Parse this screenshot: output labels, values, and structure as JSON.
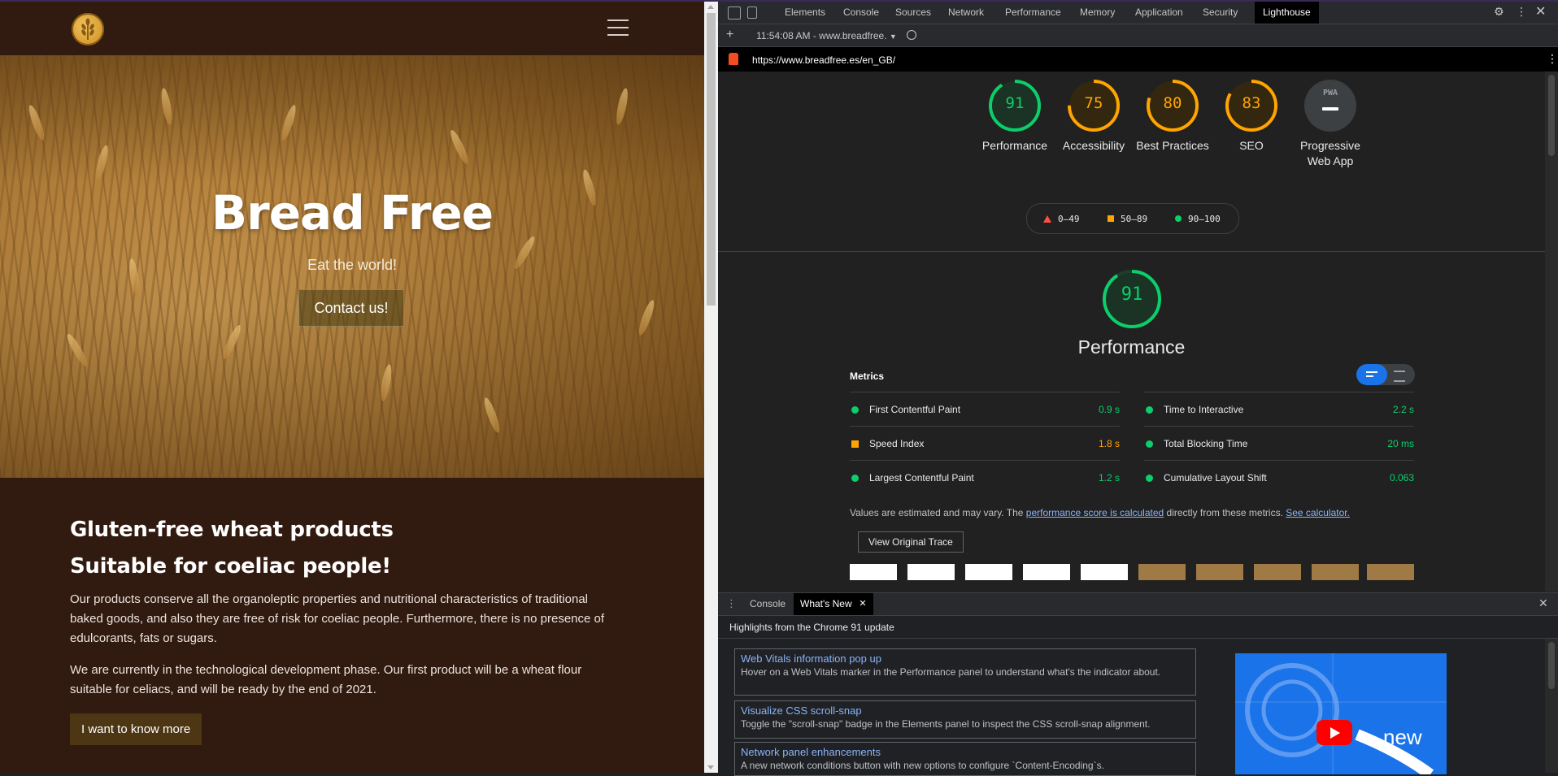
{
  "site": {
    "hero_title": "Bread Free",
    "hero_subtitle": "Eat the world!",
    "hero_button": "Contact us!",
    "heading_1": "Gluten-free wheat products",
    "heading_2": "Suitable for coeliac people!",
    "paragraph_1": "Our products conserve all the organoleptic properties and nutritional characteristics of traditional baked goods, and also they are free of risk for coeliac people. Furthermore, there is no presence of edulcorants, fats or sugars.",
    "paragraph_2": "We are currently in the technological development phase. Our first product will be a wheat flour suitable for celiacs, and will be ready by the end of 2021.",
    "know_button": "I want to know more"
  },
  "devtools": {
    "tabs": [
      "Elements",
      "Console",
      "Sources",
      "Network",
      "Performance",
      "Memory",
      "Application",
      "Security",
      "Lighthouse"
    ],
    "active_tab": "Lighthouse",
    "report_selector": "11:54:08 AM - www.breadfree.",
    "url": "https://www.breadfree.es/en_GB/"
  },
  "lighthouse": {
    "scores": [
      {
        "label": "Performance",
        "value": "91",
        "score": 91,
        "color": "#0cce6b"
      },
      {
        "label": "Accessibility",
        "value": "75",
        "score": 75,
        "color": "#ffa400"
      },
      {
        "label": "Best Practices",
        "value": "80",
        "score": 80,
        "color": "#ffa400"
      },
      {
        "label": "SEO",
        "value": "83",
        "score": 83,
        "color": "#ffa400"
      },
      {
        "label": "Progressive Web App",
        "value": "PWA",
        "score": 0,
        "color": "#9aa0a6"
      }
    ],
    "legend": [
      "0–49",
      "50–89",
      "90–100"
    ],
    "legend_colors": [
      "#ff4e42",
      "#ffa400",
      "#0cce6b"
    ],
    "performance_score": "91",
    "performance_title": "Performance",
    "metrics_heading": "Metrics",
    "metrics": [
      {
        "name": "First Contentful Paint",
        "value": "0.9 s",
        "rating": "good"
      },
      {
        "name": "Time to Interactive",
        "value": "2.2 s",
        "rating": "good"
      },
      {
        "name": "Speed Index",
        "value": "1.8 s",
        "rating": "average"
      },
      {
        "name": "Total Blocking Time",
        "value": "20 ms",
        "rating": "good"
      },
      {
        "name": "Largest Contentful Paint",
        "value": "1.2 s",
        "rating": "good"
      },
      {
        "name": "Cumulative Layout Shift",
        "value": "0.063",
        "rating": "good"
      }
    ],
    "note_prefix": "Values are estimated and may vary. The ",
    "note_link1": "performance score is calculated",
    "note_middle": " directly from these metrics. ",
    "note_link2": "See calculator.",
    "trace_button": "View Original Trace"
  },
  "drawer": {
    "tabs": [
      "Console",
      "What's New"
    ],
    "active_tab": "What's New",
    "header": "Highlights from the Chrome 91 update",
    "items": [
      {
        "title": "Web Vitals information pop up",
        "desc": "Hover on a Web Vitals marker in the Performance panel to understand what's the indicator about."
      },
      {
        "title": "Visualize CSS scroll-snap",
        "desc": "Toggle the \"scroll-snap\" badge in the Elements panel to inspect the CSS scroll-snap alignment."
      },
      {
        "title": "Network panel enhancements",
        "desc": "A new network conditions button with new options to configure `Content-Encoding`s."
      }
    ],
    "video_text": "new"
  }
}
